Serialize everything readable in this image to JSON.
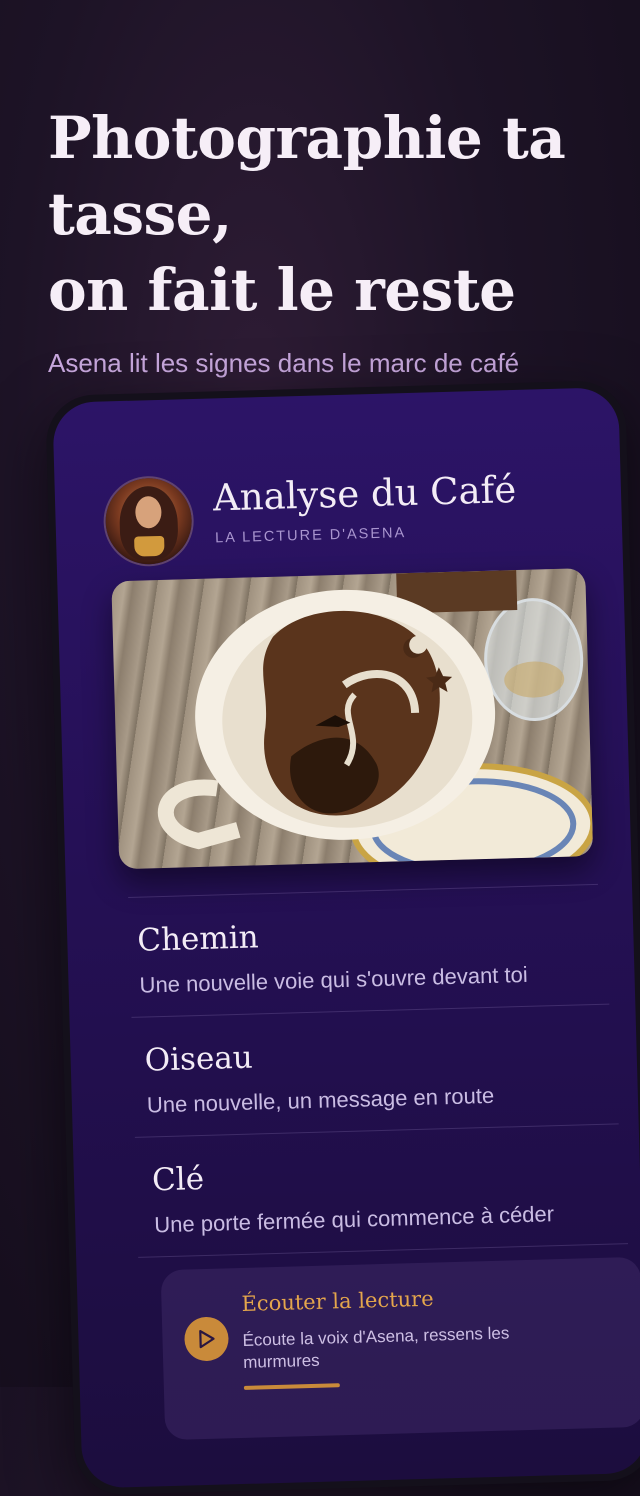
{
  "hero": {
    "title_lines": [
      "Photographie ta",
      "tasse,",
      "on fait le reste"
    ],
    "subtitle": "Asena lit les signes dans le marc de café"
  },
  "app": {
    "title": "Analyse du Café",
    "subtitle": "LA LECTURE D'ASENA"
  },
  "symbols": [
    {
      "name": "Chemin",
      "description": "Une nouvelle voie qui s'ouvre devant toi"
    },
    {
      "name": "Oiseau",
      "description": "Une nouvelle, un message en route"
    },
    {
      "name": "Clé",
      "description": "Une porte fermée qui commence à céder"
    }
  ],
  "listen": {
    "title": "Écouter la lecture",
    "description": "Écoute la voix d'Asena, ressens les murmures"
  },
  "colors": {
    "accent": "#c98a3a",
    "screen_bg": "#2c1467",
    "subtitle_lilac": "#c7a7dd"
  },
  "icons": [
    "play-icon"
  ]
}
